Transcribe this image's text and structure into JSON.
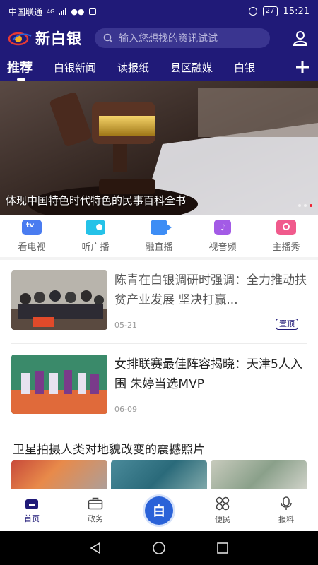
{
  "status": {
    "carrier": "中国联通",
    "network": "4G",
    "battery": "27",
    "time": "15:21"
  },
  "header": {
    "logo_text": "新白银",
    "search_placeholder": "输入您想找的资讯试试"
  },
  "tabs": [
    {
      "label": "推荐",
      "active": true
    },
    {
      "label": "白银新闻"
    },
    {
      "label": "读报纸"
    },
    {
      "label": "县区融媒"
    },
    {
      "label": "白银"
    }
  ],
  "banner": {
    "caption": "体现中国特色时代特色的民事百科全书"
  },
  "shortcuts": [
    {
      "label": "看电视",
      "icon": "tv-icon",
      "color": "#4a7cf0"
    },
    {
      "label": "听广播",
      "icon": "radio-icon",
      "color": "#25c2e8"
    },
    {
      "label": "融直播",
      "icon": "video-camera-icon",
      "color": "#3d8df5"
    },
    {
      "label": "视音频",
      "icon": "music-icon",
      "color": "#a35be6"
    },
    {
      "label": "主播秀",
      "icon": "camera-icon",
      "color": "#f05a8c"
    }
  ],
  "feed": {
    "articles": [
      {
        "title": "陈青在白银调研时强调：全力推动扶贫产业发展 坚决打赢...",
        "date": "05-21",
        "badge": "置顶"
      },
      {
        "title": "女排联赛最佳阵容揭晓：天津5人入围 朱婷当选MVP",
        "date": "06-09"
      }
    ],
    "gallery_title": "卫星拍摄人类对地貌改变的震撼照片"
  },
  "bottom_nav": [
    {
      "label": "首页",
      "icon": "home-icon",
      "active": true
    },
    {
      "label": "政务",
      "icon": "briefcase-icon"
    },
    {
      "label": "",
      "icon": "center-logo-icon"
    },
    {
      "label": "便民",
      "icon": "grid-icon"
    },
    {
      "label": "报料",
      "icon": "microphone-icon"
    }
  ],
  "colors": {
    "brand": "#201a78",
    "accent": "#2a62d8",
    "dot_active": "#e22233"
  }
}
